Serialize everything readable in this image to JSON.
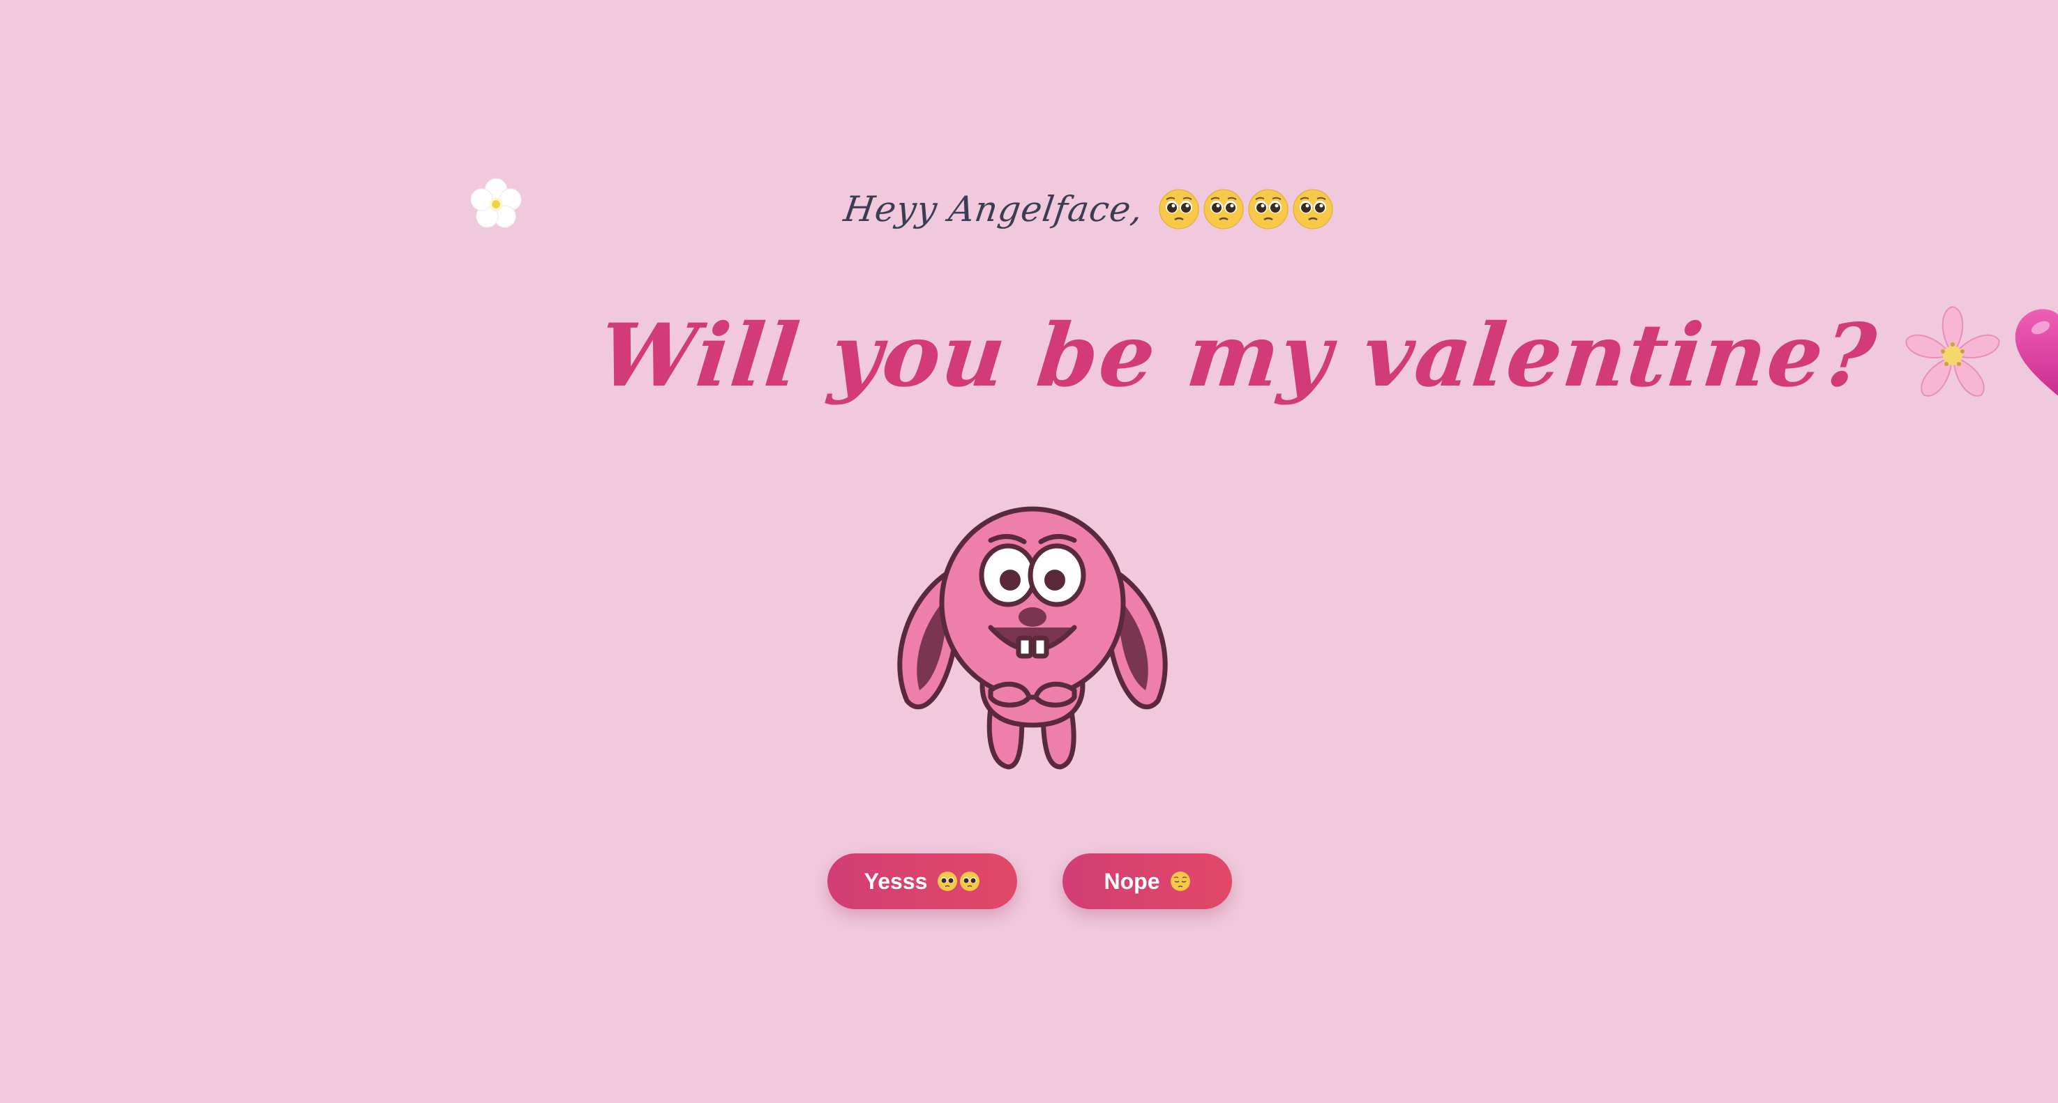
{
  "greeting": {
    "text": "Heyy Angelface,",
    "emoji": "pleading-face-emoji",
    "emoji_count": 4
  },
  "title": {
    "text": "Will you be my valentine?",
    "emojis": [
      "cherry-blossom-emoji",
      "pink-heart-emoji"
    ]
  },
  "buttons": {
    "yes_label": "Yesss",
    "yes_emojis": [
      "pleading-face-emoji",
      "pleading-face-emoji"
    ],
    "no_label": "Nope",
    "no_emoji": "pensive-face-emoji"
  },
  "decorations": {
    "flower_icon": "white-flower-icon",
    "bunny": "pink-bunny-illustration"
  },
  "colors": {
    "background": "#f0c9dc",
    "title": "#d23a78",
    "greeting": "#3c3d55",
    "button_start": "#d13e75",
    "button_end": "#e24866",
    "bunny_fill": "#ee7faa",
    "bunny_outline": "#5a2a3c"
  }
}
